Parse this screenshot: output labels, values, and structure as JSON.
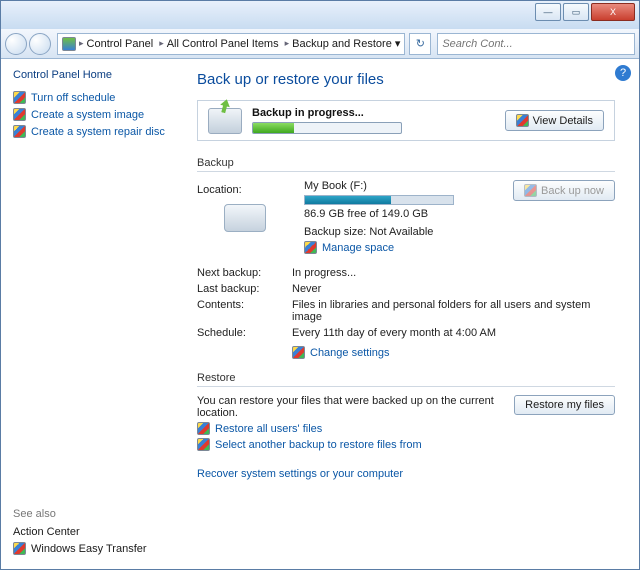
{
  "titlebar": {
    "close": "X",
    "max": "▭",
    "min": "—"
  },
  "toolbar": {
    "breadcrumb": [
      "Control Panel",
      "All Control Panel Items",
      "Backup and Restore"
    ],
    "search_placeholder": "Search Cont..."
  },
  "sidebar": {
    "home": "Control Panel Home",
    "links": [
      "Turn off schedule",
      "Create a system image",
      "Create a system repair disc"
    ],
    "seealso_label": "See also",
    "seealso": [
      {
        "label": "Action Center",
        "shield": false
      },
      {
        "label": "Windows Easy Transfer",
        "shield": true
      }
    ]
  },
  "main": {
    "heading": "Back up or restore your files",
    "help": "?",
    "progress": {
      "status": "Backup in progress...",
      "view_details": "View Details"
    },
    "backup_section": "Backup",
    "backup": {
      "location_label": "Location:",
      "location_value": "My Book (F:)",
      "space_line": "86.9 GB free of 149.0 GB",
      "size_line": "Backup size: Not Available",
      "manage_space": "Manage space",
      "backup_now": "Back up now",
      "rows": [
        {
          "k": "Next backup:",
          "v": "In progress..."
        },
        {
          "k": "Last backup:",
          "v": "Never"
        },
        {
          "k": "Contents:",
          "v": "Files in libraries and personal folders for all users and system image"
        },
        {
          "k": "Schedule:",
          "v": "Every 11th day of every month at 4:00 AM"
        }
      ],
      "change_settings": "Change settings"
    },
    "restore_section": "Restore",
    "restore": {
      "blurb": "You can restore your files that were backed up on the current location.",
      "restore_my_files": "Restore my files",
      "restore_all": "Restore all users' files",
      "select_another": "Select another backup to restore files from",
      "recover": "Recover system settings or your computer"
    }
  }
}
